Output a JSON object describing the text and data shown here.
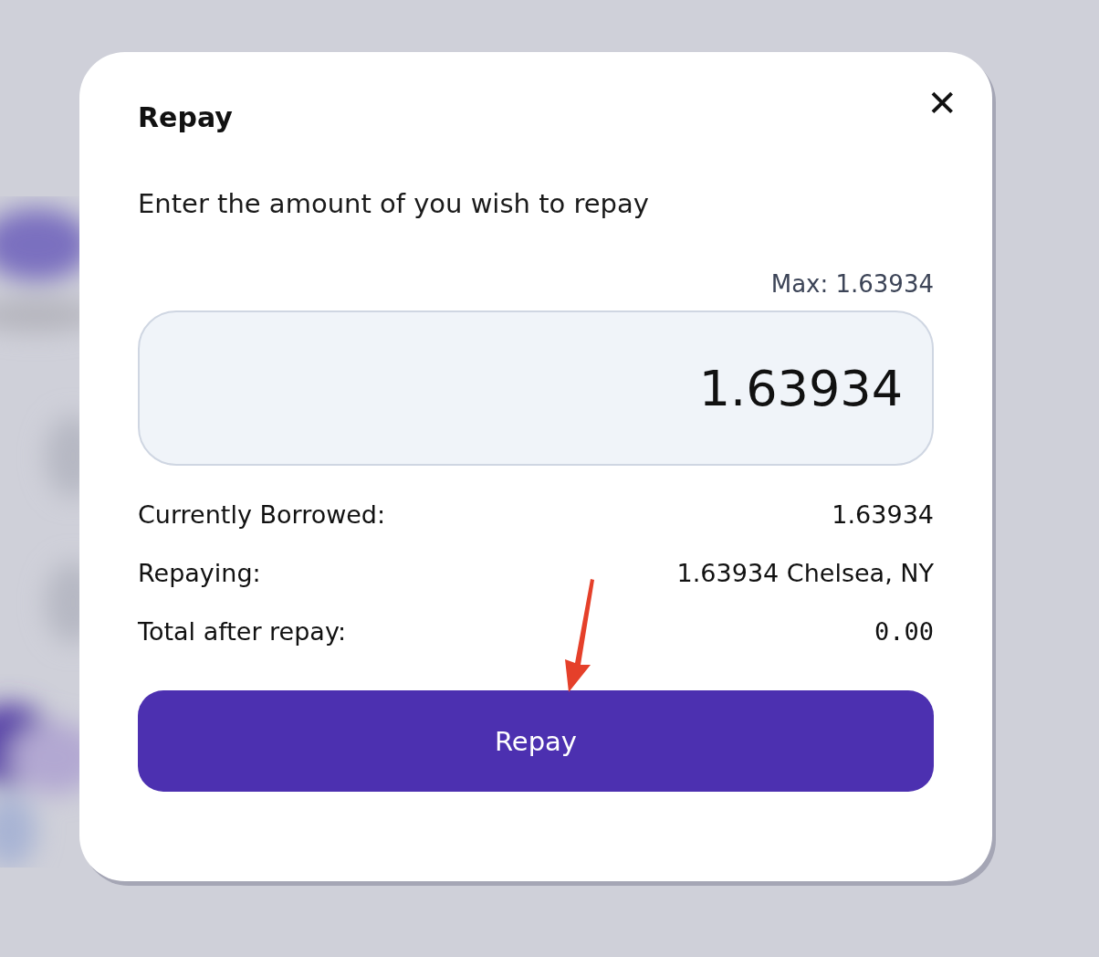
{
  "dialog": {
    "title": "Repay",
    "close": "✕",
    "prompt": "Enter the amount of you wish to repay",
    "max_label": "Max: 1.63934",
    "amount_field": {
      "value": "1.63934"
    },
    "summary": [
      {
        "label": "Currently Borrowed:",
        "value": "1.63934",
        "kind": "text"
      },
      {
        "label": "Repaying:",
        "value": "1.63934 Chelsea, NY",
        "kind": "text"
      },
      {
        "label": "Total after repay:",
        "value": "0.00",
        "kind": "mono"
      }
    ],
    "button": "Repay"
  }
}
